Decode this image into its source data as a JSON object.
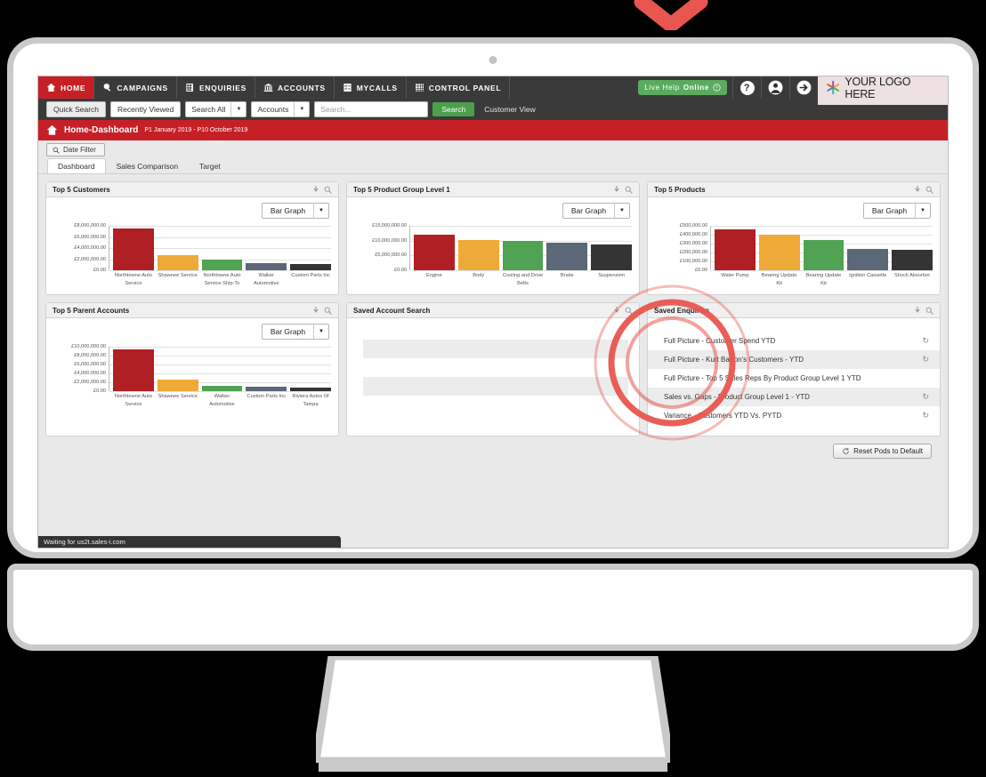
{
  "colors": {
    "brand_red": "#c62026",
    "nav_dark": "#3a3a3a",
    "green": "#4ba04e",
    "ripple": "#e8564f",
    "bar_red": "#b01f24",
    "bar_orange": "#efa937",
    "bar_green": "#50a352",
    "bar_slate": "#5a6878",
    "bar_dark": "#343434"
  },
  "nav": {
    "items": [
      {
        "label": "HOME",
        "icon": "home-icon",
        "active": true
      },
      {
        "label": "CAMPAIGNS",
        "icon": "megaphone-icon",
        "active": false
      },
      {
        "label": "ENQUIRIES",
        "icon": "document-search-icon",
        "active": false
      },
      {
        "label": "ACCOUNTS",
        "icon": "bank-icon",
        "active": false
      },
      {
        "label": "MYCALLS",
        "icon": "checklist-icon",
        "active": false
      },
      {
        "label": "CONTROL PANEL",
        "icon": "grid-icon",
        "active": false
      }
    ],
    "live_help": "Live Help",
    "live_help_status": "Online",
    "help_icon": "question-mark-icon",
    "user_icon": "user-avatar-icon",
    "logout_icon": "arrow-right-exit-icon",
    "logo_text": "YOUR LOGO HERE",
    "logo_icon": "star-burst-logo-icon"
  },
  "search": {
    "quick_search": "Quick Search",
    "recently_viewed": "Recently Viewed",
    "scope": "Search All",
    "entity": "Accounts",
    "placeholder": "Search...",
    "button": "Search",
    "customer_view": "Customer View"
  },
  "page": {
    "title": "Home-Dashboard",
    "period": "P1 January 2019 - P10 October 2019",
    "home_icon": "home-icon",
    "date_filter": "Date Filter",
    "date_filter_icon": "magnifier-icon",
    "tabs": [
      {
        "label": "Dashboard",
        "active": true
      },
      {
        "label": "Sales Comparison",
        "active": false
      },
      {
        "label": "Target",
        "active": false
      }
    ],
    "reset_button": "Reset Pods to Default",
    "reset_icon": "refresh-icon",
    "status": "Waiting for us2t.sales-i.com"
  },
  "pod_icons": {
    "pin": "pin-icon",
    "zoom": "magnifier-icon"
  },
  "graph_select": {
    "value": "Bar Graph",
    "caret": "chevron-down-icon"
  },
  "chart_data": [
    {
      "type": "bar",
      "title": "Top 5 Customers",
      "categories": [
        "Northtowne Auto Service",
        "Shawnee Service",
        "Northtowne Auto Service Ship-To",
        "Walker Automotive",
        "Custom Parts Inc"
      ],
      "values": [
        7500000,
        2700000,
        1900000,
        1300000,
        1050000
      ],
      "colors": [
        "#b01f24",
        "#efa937",
        "#50a352",
        "#5a6878",
        "#343434"
      ],
      "ylim": [
        0,
        8000000
      ],
      "yticks": [
        0,
        2000000,
        4000000,
        6000000,
        8000000
      ],
      "ytick_labels": [
        "£0.00",
        "£2,000,000.00",
        "£4,000,000.00",
        "£6,000,000.00",
        "£8,000,000.00"
      ],
      "xlabel": "",
      "ylabel": "",
      "grid": true,
      "legend": false
    },
    {
      "type": "bar",
      "title": "Top 5 Product Group Level 1",
      "categories": [
        "Engine",
        "Body",
        "Cooling and Drive Belts",
        "Brake",
        "Suspension"
      ],
      "values": [
        12000000,
        10100000,
        9900000,
        9400000,
        8700000
      ],
      "colors": [
        "#b01f24",
        "#efa937",
        "#50a352",
        "#5a6878",
        "#343434"
      ],
      "ylim": [
        0,
        15000000
      ],
      "yticks": [
        0,
        5000000,
        10000000,
        15000000
      ],
      "ytick_labels": [
        "£0.00",
        "£5,000,000.00",
        "£10,000,000.00",
        "£15,000,000.00"
      ],
      "xlabel": "",
      "ylabel": "",
      "grid": true,
      "legend": false
    },
    {
      "type": "bar",
      "title": "Top 5 Products",
      "categories": [
        "Water Pump",
        "Bearing Update Kit",
        "Bearing Update Kit",
        "Ignition Cassette",
        "Shock Absorber"
      ],
      "values": [
        460000,
        400000,
        345000,
        240000,
        230000
      ],
      "colors": [
        "#b01f24",
        "#efa937",
        "#50a352",
        "#5a6878",
        "#343434"
      ],
      "ylim": [
        0,
        500000
      ],
      "yticks": [
        0,
        100000,
        200000,
        300000,
        400000,
        500000
      ],
      "ytick_labels": [
        "£0.00",
        "£100,000.00",
        "£200,000.00",
        "£300,000.00",
        "£400,000.00",
        "£500,000.00"
      ],
      "xlabel": "",
      "ylabel": "",
      "grid": true,
      "legend": false
    },
    {
      "type": "bar",
      "title": "Top 5 Parent Accounts",
      "categories": [
        "Northtowne Auto Service",
        "Shawnee Service",
        "Walker Automotive",
        "Custom Parts Inc",
        "Riviera Autos Of Tampa"
      ],
      "values": [
        9400000,
        2700000,
        1200000,
        1050000,
        900000
      ],
      "colors": [
        "#b01f24",
        "#efa937",
        "#50a352",
        "#5a6878",
        "#343434"
      ],
      "ylim": [
        0,
        10000000
      ],
      "yticks": [
        0,
        2000000,
        4000000,
        6000000,
        8000000,
        10000000
      ],
      "ytick_labels": [
        "£0.00",
        "£2,000,000.00",
        "£4,000,000.00",
        "£6,000,000.00",
        "£8,000,000.00",
        "£10,000,000.00"
      ],
      "xlabel": "",
      "ylabel": "",
      "grid": true,
      "legend": false
    }
  ],
  "saved_account_search": {
    "title": "Saved Account Search",
    "rows": [
      "",
      ""
    ]
  },
  "saved_enquiries": {
    "title": "Saved Enquiries",
    "refresh_icon": "refresh-icon",
    "items": [
      {
        "label": "Full Picture - Customer Spend YTD",
        "refresh": true
      },
      {
        "label": "Full Picture - Kurt Barton's Customers - YTD",
        "refresh": true
      },
      {
        "label": "Full Picture - Top 5 Sales Reps By Product Group Level 1 YTD",
        "refresh": false
      },
      {
        "label": "Sales vs. Gaps - Product Group Level 1 - YTD",
        "refresh": true
      },
      {
        "label": "Variance - Customers YTD Vs. PYTD",
        "refresh": true
      }
    ]
  },
  "annotation": {
    "chevron_icon": "chevron-down-arrow-icon",
    "ripple_icon": "ripple-highlight-icon"
  }
}
